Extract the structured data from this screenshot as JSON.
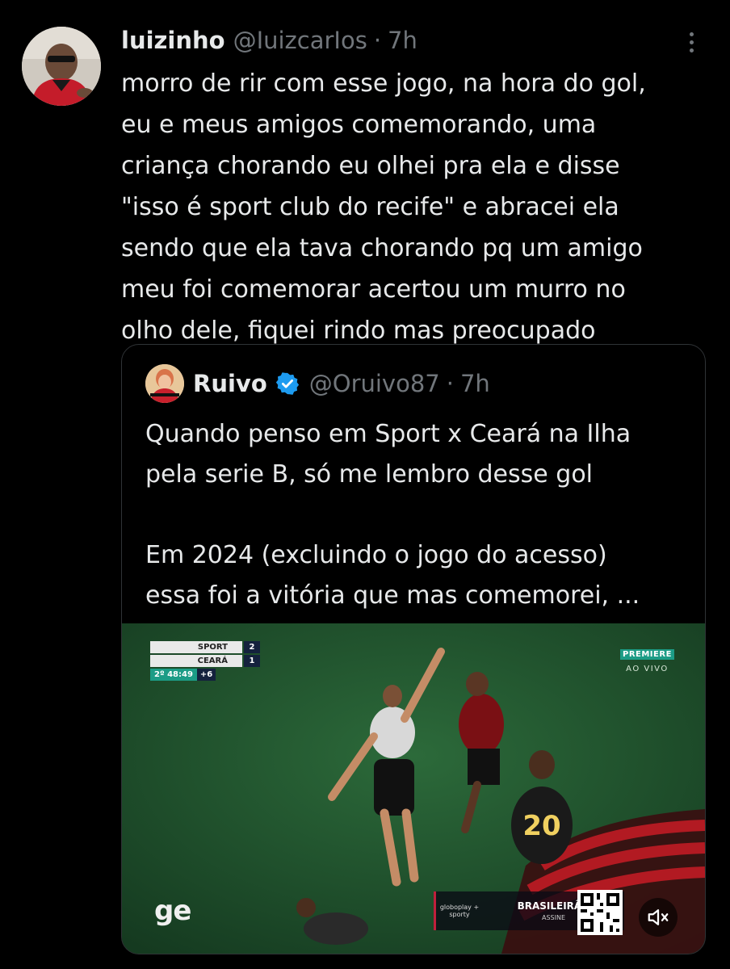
{
  "tweet": {
    "author_name": "luizinho",
    "handle": "@IuizcarIos",
    "separator": "·",
    "time": "7h",
    "text": "morro de rir com esse jogo, na hora do gol,\neu e meus amigos comemorando, uma\ncriança chorando eu olhei pra ela e disse\n\"isso é sport club do recife\" e abracei ela\nsendo que ela tava chorando pq um amigo\nmeu foi comemorar acertou um murro no\nolho dele, fiquei rindo mas preocupado"
  },
  "quote": {
    "author_name": "Ruivo",
    "handle": "@Oruivo87",
    "separator": "·",
    "time": "7h",
    "text": "Quando penso em Sport x Ceará na Ilha\npela serie B, só me lembro desse gol\n\nEm 2024 (excluindo o jogo do acesso)\nessa foi a vitória que mas comemorei, ...",
    "video": {
      "scoreboard": {
        "home_team": "SPORT",
        "home_score": "2",
        "away_team": "CEARÁ",
        "away_score": "1",
        "clock": "2º 48:49",
        "added_time": "+6"
      },
      "broadcaster": "PREMIERE",
      "live_label": "AO VIVO",
      "watermark": "ge",
      "ad_logo": "globoplay + sporty",
      "ad_title": "BRASILEIRÃO",
      "ad_subtitle": "ASSINE"
    }
  },
  "colors": {
    "background": "#000000",
    "text": "#e7e9ea",
    "muted": "#71767b",
    "border": "#2f3336",
    "verified": "#1d9bf0"
  },
  "icons": [
    "more-options-icon",
    "verified-badge-icon",
    "mute-icon"
  ]
}
